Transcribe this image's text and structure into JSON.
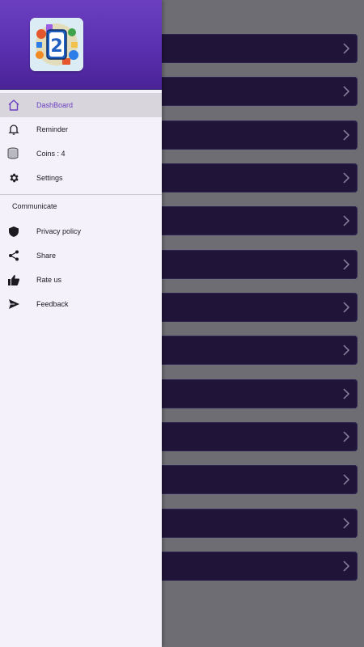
{
  "drawer": {
    "main_items": [
      {
        "label": "DashBoard",
        "icon": "home-icon",
        "active": true
      },
      {
        "label": "Reminder",
        "icon": "bell-icon",
        "active": false
      },
      {
        "label": "Coins : 4",
        "icon": "coins-icon",
        "active": false
      },
      {
        "label": "Settings",
        "icon": "gear-icon",
        "active": false
      }
    ],
    "section_title": "Communicate",
    "communicate_items": [
      {
        "label": "Privacy policy",
        "icon": "shield-icon"
      },
      {
        "label": "Share",
        "icon": "share-icon"
      },
      {
        "label": "Rate us",
        "icon": "thumbs-up-icon"
      },
      {
        "label": "Feedback",
        "icon": "send-icon"
      }
    ]
  },
  "background_list": {
    "row_count": 13
  },
  "colors": {
    "accent": "#6a3fc1",
    "drawer_background": "#f4f1fa",
    "row_background": "#201538"
  }
}
